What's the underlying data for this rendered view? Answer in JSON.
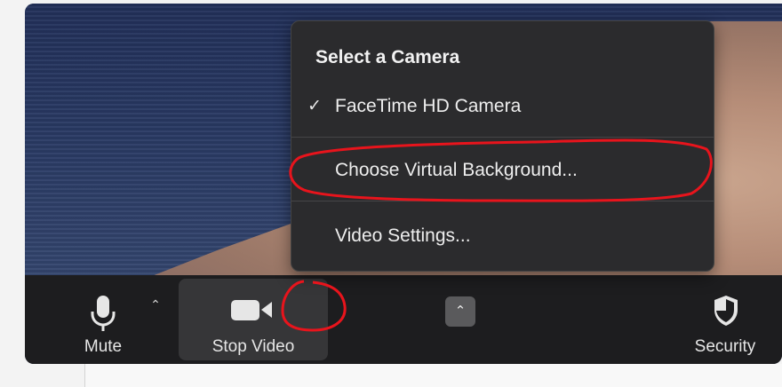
{
  "camera_menu": {
    "title": "Select a Camera",
    "items": [
      {
        "label": "FaceTime HD Camera",
        "checked": true
      },
      {
        "label": "Choose Virtual Background...",
        "checked": false
      },
      {
        "label": "Video Settings...",
        "checked": false
      }
    ],
    "check_glyph": "✓"
  },
  "toolbar": {
    "mute_label": "Mute",
    "stop_video_label": "Stop Video",
    "security_label": "Security",
    "chevron_glyph": "⌃"
  },
  "icons": {
    "mute": "microphone-icon",
    "stop_video": "video-camera-icon",
    "security": "shield-icon",
    "chevron": "chevron-up-icon",
    "check": "checkmark-icon"
  },
  "colors": {
    "annotation": "#e8141c",
    "toolbar_bg": "#1d1d1f",
    "menu_bg": "#2b2b2d",
    "active_button_bg": "#363638"
  }
}
